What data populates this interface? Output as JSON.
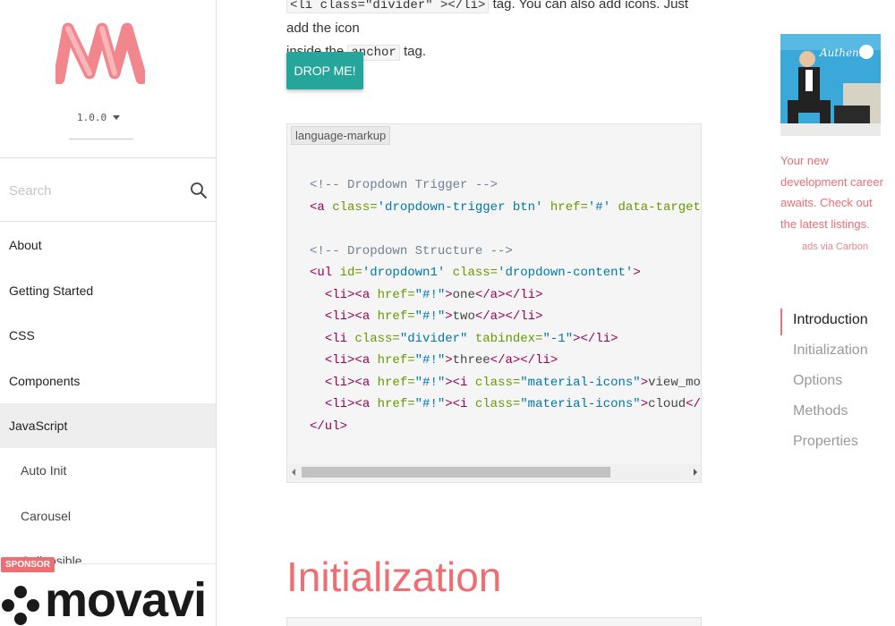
{
  "sidebar": {
    "version": "1.0.0",
    "search_placeholder": "Search",
    "items": [
      {
        "label": "About"
      },
      {
        "label": "Getting Started"
      },
      {
        "label": "CSS"
      },
      {
        "label": "Components"
      },
      {
        "label": "JavaScript"
      },
      {
        "label": "Auto Init"
      },
      {
        "label": "Carousel"
      },
      {
        "label": "Collapsible"
      }
    ],
    "sponsor_label": "SPONSOR",
    "sponsor_brand": "movavi"
  },
  "main": {
    "intro_partial_1": "<li class=\"divider\" ></li>",
    "intro_partial_2": "tag. You can also add icons. Just add the icon",
    "intro_line_2a": "inside the",
    "intro_chip": "anchor",
    "intro_line_2b": "tag.",
    "button_label": "DROP ME!",
    "code_lang": "language-markup",
    "section_heading": "Initialization"
  },
  "carbon": {
    "ad_text": "Your new development career awaits. Check out the latest listings.",
    "via": "ads via Carbon",
    "image_caption": "Authentic"
  },
  "toc": {
    "items": [
      {
        "label": "Introduction"
      },
      {
        "label": "Initialization"
      },
      {
        "label": "Options"
      },
      {
        "label": "Methods"
      },
      {
        "label": "Properties"
      }
    ]
  },
  "colors": {
    "accent": "#ee6e73",
    "button": "#26a69a",
    "code_bg": "#f5f5f5"
  }
}
